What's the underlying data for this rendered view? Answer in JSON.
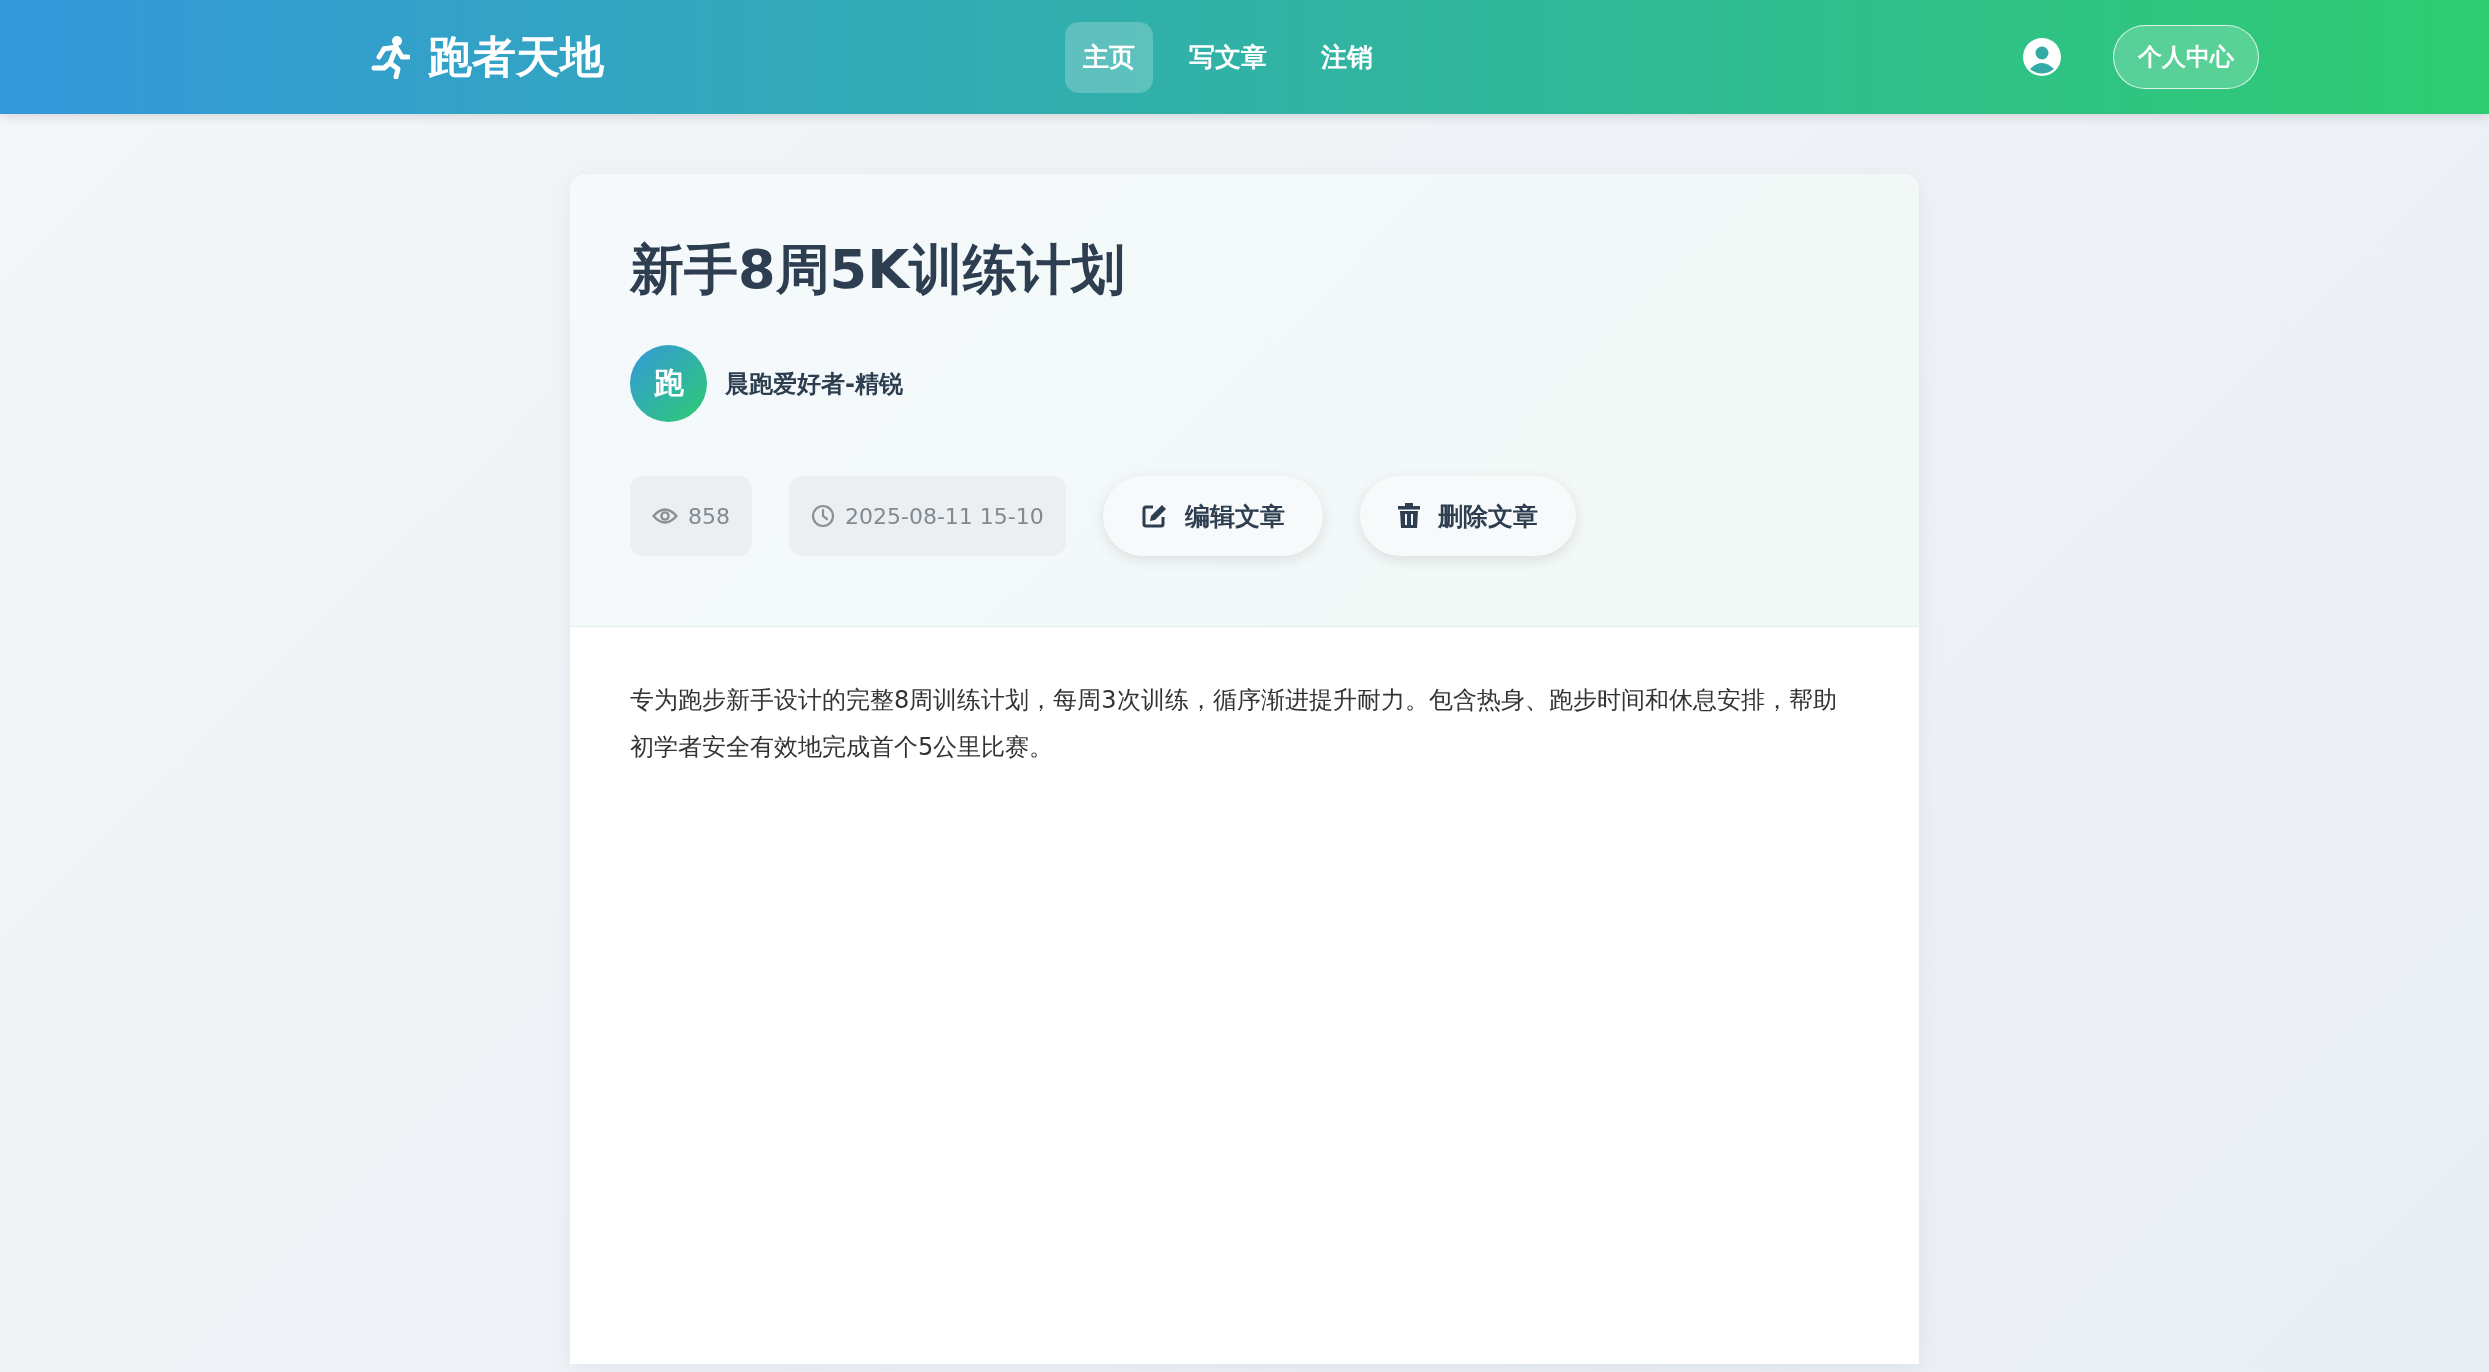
{
  "header": {
    "brand": "跑者天地",
    "nav": [
      {
        "label": "主页",
        "selected": true
      },
      {
        "label": "写文章",
        "selected": false
      },
      {
        "label": "注销",
        "selected": false
      }
    ],
    "profile_button": "个人中心"
  },
  "article": {
    "title": "新手8周5K训练计划",
    "author": {
      "avatar_text": "跑",
      "name": "晨跑爱好者-精锐"
    },
    "meta": [
      {
        "kind": "views",
        "text": "858"
      },
      {
        "kind": "date",
        "text": "2025-08-11 15-10"
      }
    ],
    "actions": [
      {
        "kind": "edit",
        "label": "编辑文章"
      },
      {
        "kind": "delete",
        "label": "删除文章"
      }
    ],
    "body": "专为跑步新手设计的完整8周训练计划，每周3次训练，循序渐进提升耐力。包含热身、跑步时间和休息安排，帮助初学者安全有效地完成首个5公里比赛。"
  }
}
